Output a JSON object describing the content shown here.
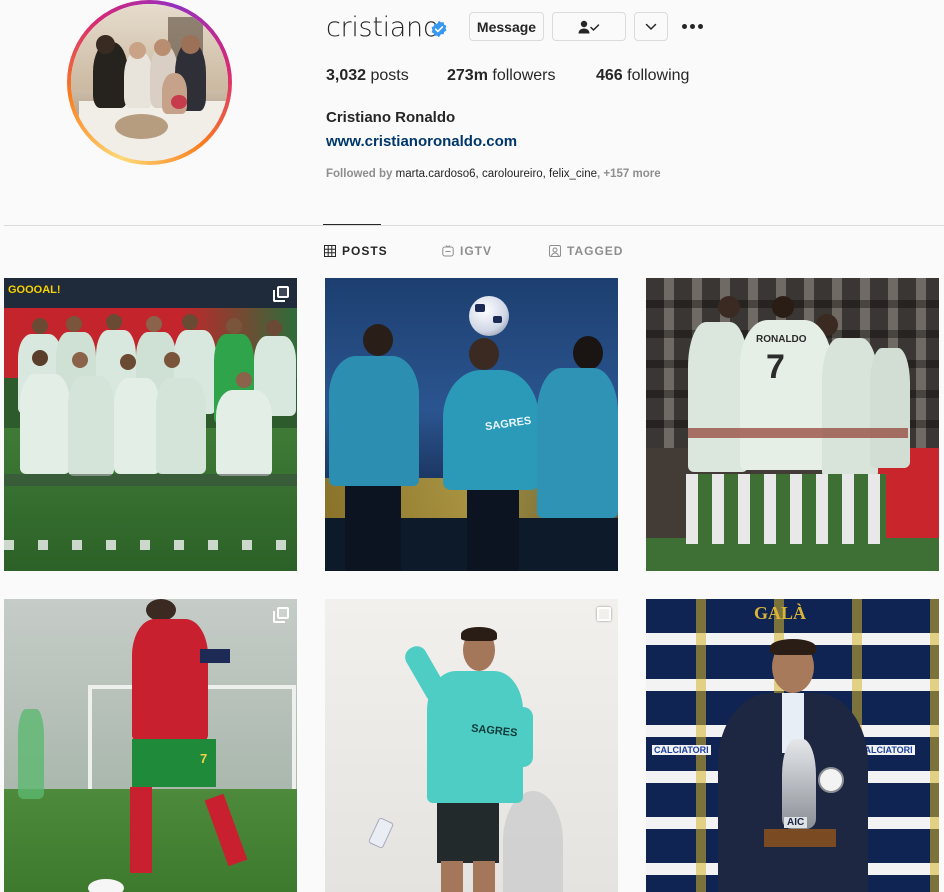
{
  "profile": {
    "username": "cristiano",
    "verified": true,
    "buttons": {
      "message": "Message",
      "following_icon": "person-check-icon",
      "dropdown_icon": "chevron-down-icon",
      "more_icon": "more-options-icon"
    },
    "stats": {
      "posts_count": "3,032",
      "posts_label": "posts",
      "followers_count": "273m",
      "followers_label": "followers",
      "following_count": "466",
      "following_label": "following"
    },
    "full_name": "Cristiano Ronaldo",
    "website": "www.cristianoronaldo.com",
    "followed_by": {
      "prefix": "Followed by",
      "names": "marta.cardoso6, caroloureiro, felix_cine",
      "more": "+157 more"
    }
  },
  "tabs": [
    {
      "label": "POSTS",
      "icon": "grid-icon",
      "active": true
    },
    {
      "label": "IGTV",
      "icon": "igtv-icon",
      "active": false
    },
    {
      "label": "TAGGED",
      "icon": "tagged-icon",
      "active": false
    }
  ],
  "posts": [
    {
      "type": "carousel",
      "subject": "team-photo",
      "banner_text": "GOOOAL!"
    },
    {
      "type": "single",
      "subject": "training-ball-header",
      "shirt_text": "SAGRES"
    },
    {
      "type": "single",
      "subject": "team-celebration",
      "shirt_text": "RONALDO",
      "shirt_number": "7"
    },
    {
      "type": "carousel",
      "subject": "player-dribbling",
      "shirt_number": "7"
    },
    {
      "type": "carousel",
      "subject": "player-thumbs-up",
      "shirt_text": "SAGRES"
    },
    {
      "type": "single",
      "subject": "award-ceremony",
      "banner_text": "GALÀ",
      "banner_sub": "CALCIATORI",
      "trophy_text": "AIC"
    }
  ],
  "colors": {
    "accent_link": "#00376b",
    "verified_blue": "#3897f0",
    "text_primary": "#262626",
    "text_secondary": "#8e8e8e",
    "border": "#dbdbdb"
  }
}
